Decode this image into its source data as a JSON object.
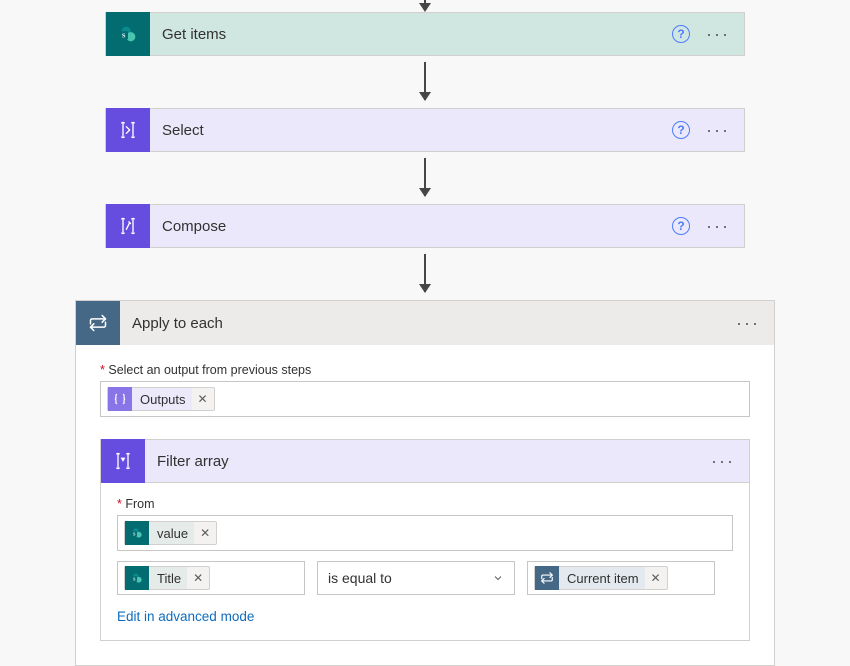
{
  "steps": {
    "getItems": {
      "title": "Get items"
    },
    "select": {
      "title": "Select"
    },
    "compose": {
      "title": "Compose"
    },
    "applyEach": {
      "title": "Apply to each"
    },
    "filter": {
      "title": "Filter array"
    }
  },
  "applyEach": {
    "fieldLabel": "Select an output from previous steps",
    "token": "Outputs"
  },
  "filter": {
    "fromLabel": "From",
    "fromToken": "value",
    "leftToken": "Title",
    "operator": "is equal to",
    "rightToken": "Current item",
    "advanced": "Edit in advanced mode"
  },
  "glyph": {
    "help": "?",
    "dots": "···",
    "close": "✕",
    "chevDown": "⌄"
  }
}
